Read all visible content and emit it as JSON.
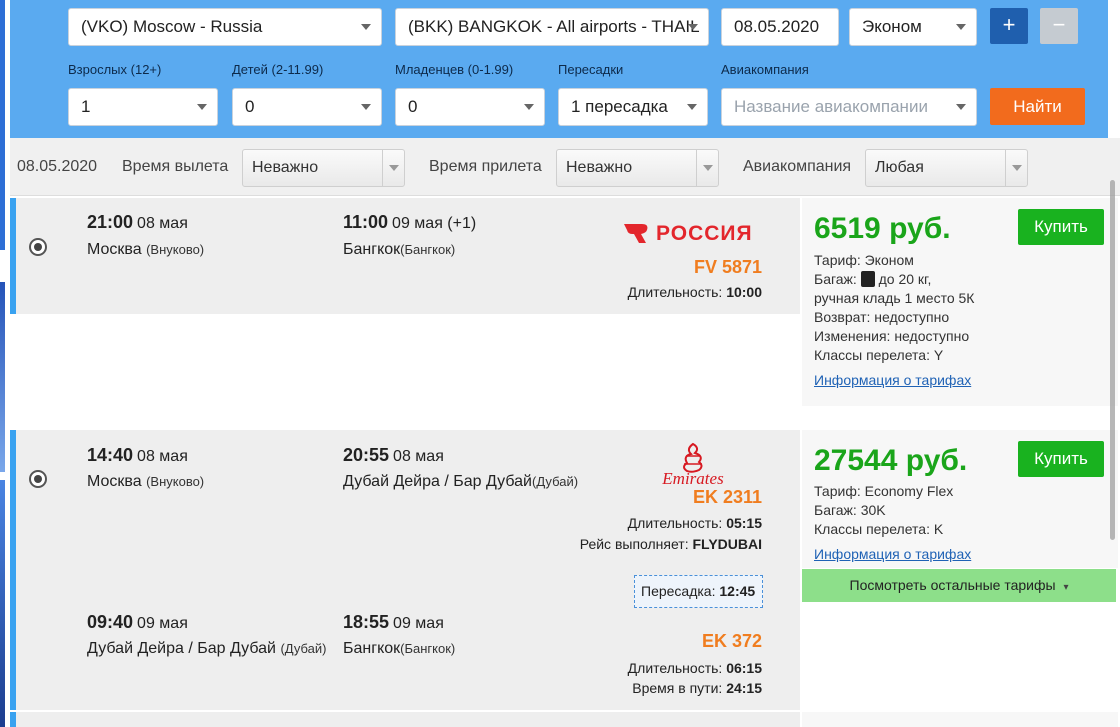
{
  "search": {
    "from": "(VKO) Moscow - Russia",
    "to": "(BKK) BANGKOK - All airports - THAIL",
    "date": "08.05.2020",
    "cabin": "Эконом",
    "plus_label": "+",
    "minus_label": "−",
    "adults_label": "Взрослых (12+)",
    "adults_value": "1",
    "children_label": "Детей (2-11.99)",
    "children_value": "0",
    "infants_label": "Младенцев (0-1.99)",
    "infants_value": "0",
    "stops_label": "Пересадки",
    "stops_value": "1 пересадка",
    "airline_label": "Авиакомпания",
    "airline_placeholder": "Название авиакомпании",
    "find_label": "Найти"
  },
  "filters": {
    "date": "08.05.2020",
    "departure_label": "Время вылета",
    "departure_value": "Неважно",
    "arrival_label": "Время прилета",
    "arrival_value": "Неважно",
    "airline_label": "Авиакомпания",
    "airline_value": "Любая"
  },
  "flights": [
    {
      "airline_logo": "РОССИЯ",
      "segments": [
        {
          "dep_time": "21:00",
          "dep_date": "08 мая",
          "dep_city": "Москва",
          "dep_airport": "(Внуково)",
          "arr_time": "11:00",
          "arr_date": "09 мая (+1)",
          "arr_city": "Бангкок",
          "arr_airport": "(Бангкок)",
          "flight_number": "FV 5871",
          "duration_label": "Длительность:",
          "duration": "10:00"
        }
      ],
      "price": "6519 руб.",
      "buy_label": "Купить",
      "tariff_lines": [
        "Тариф: Эконом",
        "Багаж:",
        "до 20 кг,",
        "ручная кладь 1 место 5К",
        "Возврат: недоступно",
        "Изменения: недоступно",
        "Классы перелета: Y"
      ],
      "info_link": "Информация о тарифах"
    },
    {
      "airline_logo": "Emirates",
      "segments": [
        {
          "dep_time": "14:40",
          "dep_date": "08 мая",
          "dep_city": "Москва",
          "dep_airport": "(Внуково)",
          "arr_time": "20:55",
          "arr_date": "08 мая",
          "arr_city": "Дубай Дейра / Бар Дубай",
          "arr_airport": "(Дубай)",
          "flight_number": "EK 2311",
          "duration_label": "Длительность:",
          "duration": "05:15",
          "operated_label": "Рейс выполняет:",
          "operated": "FLYDUBAI"
        },
        {
          "dep_time": "09:40",
          "dep_date": "09 мая",
          "dep_city": "Дубай Дейра / Бар Дубай",
          "dep_airport": "(Дубай)",
          "arr_time": "18:55",
          "arr_date": "09 мая",
          "arr_city": "Бангкок",
          "arr_airport": "(Бангкок)",
          "flight_number": "EK 372",
          "duration_label": "Длительность:",
          "duration": "06:15",
          "total_label": "Время в пути:",
          "total": "24:15"
        }
      ],
      "transfer_label": "Пересадка:",
      "transfer": "12:45",
      "price": "27544 руб.",
      "buy_label": "Купить",
      "tariff_lines": [
        "Тариф: Economy Flex",
        "Багаж: 30K",
        "Классы перелета: K"
      ],
      "info_link": "Информация о тарифах",
      "more_tariffs": "Посмотреть остальные тарифы"
    }
  ],
  "colors": {
    "search_bg": "#5aaaf0",
    "accent_blue": "#39a2f0",
    "price_green": "#1aa51a",
    "buy_green": "#19b21f",
    "flight_number_orange": "#f07d1f",
    "find_orange": "#f26b1d"
  }
}
